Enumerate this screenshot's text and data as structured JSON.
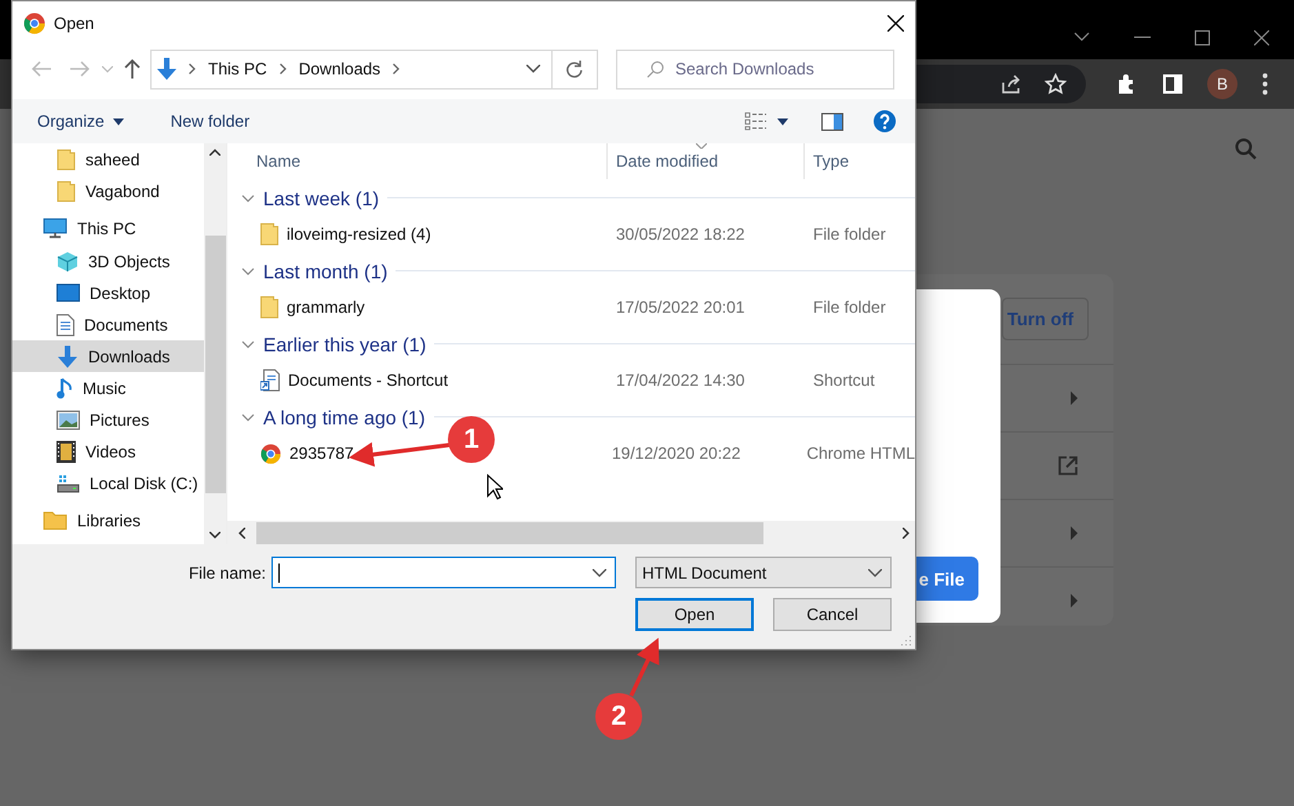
{
  "browser": {
    "profile_initial": "B",
    "turn_off_button": "Turn off",
    "file_button": "e File"
  },
  "dialog": {
    "title": "Open",
    "breadcrumb": [
      "This PC",
      "Downloads"
    ],
    "search": {
      "placeholder": "Search Downloads"
    },
    "organize": "Organize",
    "new_folder": "New folder",
    "nav_folders": [
      {
        "label": "saheed",
        "selected": false
      },
      {
        "label": "Vagabond",
        "selected": false
      }
    ],
    "nav_tree": [
      {
        "label": "This PC",
        "selected": false,
        "children": [
          {
            "label": "3D Objects",
            "selected": false
          },
          {
            "label": "Desktop",
            "selected": false
          },
          {
            "label": "Documents",
            "selected": false
          },
          {
            "label": "Downloads",
            "selected": true
          },
          {
            "label": "Music",
            "selected": false
          },
          {
            "label": "Pictures",
            "selected": false
          },
          {
            "label": "Videos",
            "selected": false
          },
          {
            "label": "Local Disk (C:)",
            "selected": false
          }
        ]
      },
      {
        "label": "Libraries",
        "selected": false
      }
    ],
    "columns": [
      "Name",
      "Date modified",
      "Type"
    ],
    "groups": [
      {
        "label": "Last week (1)",
        "expanded": true,
        "items": [
          {
            "name": "iloveimg-resized (4)",
            "date": "30/05/2022 18:22",
            "type": "File folder",
            "kind": "folder"
          }
        ]
      },
      {
        "label": "Last month (1)",
        "expanded": true,
        "items": [
          {
            "name": "grammarly",
            "date": "17/05/2022 20:01",
            "type": "File folder",
            "kind": "folder"
          }
        ]
      },
      {
        "label": "Earlier this year (1)",
        "expanded": true,
        "items": [
          {
            "name": "Documents - Shortcut",
            "date": "17/04/2022 14:30",
            "type": "Shortcut",
            "kind": "shortcut"
          }
        ]
      },
      {
        "label": "A long time ago (1)",
        "expanded": true,
        "items": [
          {
            "name": "2935787",
            "date": "19/12/2020 20:22",
            "type": "Chrome HTML",
            "kind": "chrome"
          }
        ]
      }
    ],
    "file_name_label": "File name:",
    "file_type": "HTML Document",
    "buttons": [
      {
        "label": "Open",
        "kind": "default"
      },
      {
        "label": "Cancel",
        "kind": "normal"
      }
    ]
  },
  "annotations": [
    {
      "label": "1"
    },
    {
      "label": "2"
    }
  ]
}
